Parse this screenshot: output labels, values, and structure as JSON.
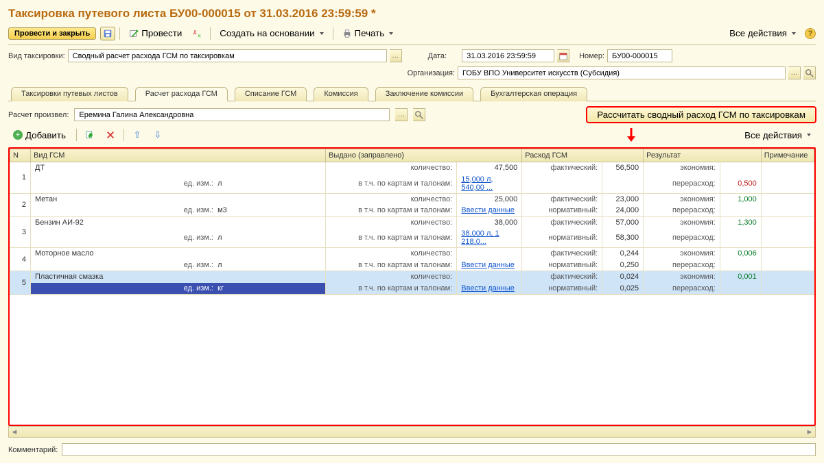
{
  "title": "Таксировка путевого листа БУ00-000015 от 31.03.2016 23:59:59 *",
  "toolbar": {
    "post_close": "Провести и закрыть",
    "post": "Провести",
    "base": "Создать на основании",
    "print": "Печать",
    "all_actions": "Все действия"
  },
  "fields": {
    "vid_lbl": "Вид таксировки:",
    "vid_val": "Сводный расчет расхода ГСМ по таксировкам",
    "date_lbl": "Дата:",
    "date_val": "31.03.2016 23:59:59",
    "num_lbl": "Номер:",
    "num_val": "БУ00-000015",
    "org_lbl": "Организация:",
    "org_val": "ГОБУ ВПО Университет искусств (Субсидия)"
  },
  "tabs": [
    "Таксировки путевых листов",
    "Расчет расхода ГСМ",
    "Списание ГСМ",
    "Комиссия",
    "Заключение комиссии",
    "Бухгалтерская операция"
  ],
  "subbar": {
    "calc_by_lbl": "Расчет произвел:",
    "calc_by_val": "Еремина Галина Александровна",
    "add": "Добавить",
    "calc_btn": "Рассчитать сводный расход ГСМ по таксировкам",
    "all_actions": "Все действия"
  },
  "headers": {
    "n": "N",
    "type": "Вид ГСМ",
    "issued": "Выдано (заправлено)",
    "usage": "Расход ГСМ",
    "result": "Результат",
    "note": "Примечание"
  },
  "row_labels": {
    "ed": "ед. изм.:",
    "qty": "количество:",
    "cards": "в т.ч. по картам и талонам:",
    "fact": "фактический:",
    "norm": "нормативный:",
    "econ": "экономия:",
    "over": "перерасход:",
    "enter": "Ввести данные"
  },
  "rows": [
    {
      "n": "1",
      "name": "ДТ",
      "unit": "л",
      "qty": "47,500",
      "cards": "15,000 л, 540,00 ...",
      "fact": "56,500",
      "norm": "",
      "econ": "",
      "over": "0,500",
      "over_cls": "redv"
    },
    {
      "n": "2",
      "name": "Метан",
      "unit": "м3",
      "qty": "25,000",
      "cards": "",
      "fact": "23,000",
      "norm": "24,000",
      "econ": "1,000",
      "over": "",
      "over_cls": ""
    },
    {
      "n": "3",
      "name": "Бензин АИ-92",
      "unit": "л",
      "qty": "38,000",
      "cards": "38,000 л, 1 218,0...",
      "fact": "57,000",
      "norm": "58,300",
      "econ": "1,300",
      "over": "",
      "over_cls": ""
    },
    {
      "n": "4",
      "name": "Моторное масло",
      "unit": "л",
      "qty": "",
      "cards": "",
      "fact": "0,244",
      "norm": "0,250",
      "econ": "0,006",
      "over": "",
      "over_cls": ""
    },
    {
      "n": "5",
      "name": "Пластичная смазка",
      "unit": "кг",
      "qty": "",
      "cards": "",
      "fact": "0,024",
      "norm": "0,025",
      "econ": "0,001",
      "over": "",
      "over_cls": ""
    }
  ],
  "comment_lbl": "Комментарий:"
}
